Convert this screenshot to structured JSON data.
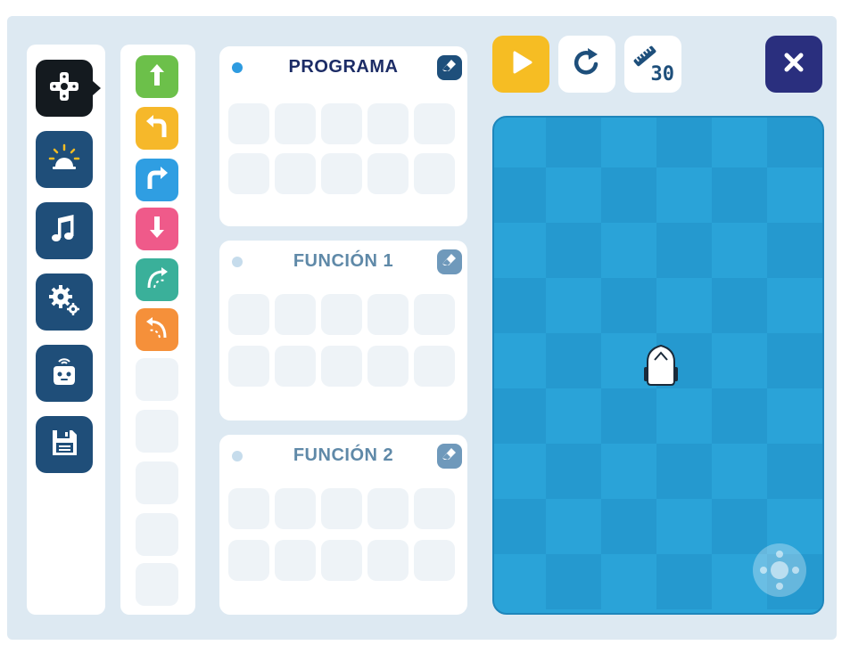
{
  "categories": [
    {
      "name": "movement",
      "icon": "dpad-icon",
      "active": true
    },
    {
      "name": "lights",
      "icon": "alarm-light-icon",
      "active": false
    },
    {
      "name": "music",
      "icon": "music-note-icon",
      "active": false
    },
    {
      "name": "settings",
      "icon": "gears-icon",
      "active": false
    },
    {
      "name": "robot",
      "icon": "robot-icon",
      "active": false
    },
    {
      "name": "save",
      "icon": "floppy-disk-icon",
      "active": false
    }
  ],
  "palette": [
    {
      "icon": "arrow-up-icon",
      "color": "#6cc04a"
    },
    {
      "icon": "turn-left-icon",
      "color": "#f6b82a"
    },
    {
      "icon": "turn-right-icon",
      "color": "#2f9ee2"
    },
    {
      "icon": "arrow-down-icon",
      "color": "#ef5a8a"
    },
    {
      "icon": "curve-right-icon",
      "color": "#3ab09a"
    },
    {
      "icon": "curve-left-icon",
      "color": "#f5903a"
    }
  ],
  "panels": {
    "programa": {
      "title": "PROGRAMA"
    },
    "funcion1": {
      "title": "FUNCIÓN 1"
    },
    "funcion2": {
      "title": "FUNCIÓN 2"
    }
  },
  "toolbar": {
    "measure_value": "30"
  },
  "colors": {
    "play": "#f6bd23",
    "close": "#2a2f7e",
    "board": "#2aa3d8",
    "accent": "#1e4f7b"
  }
}
